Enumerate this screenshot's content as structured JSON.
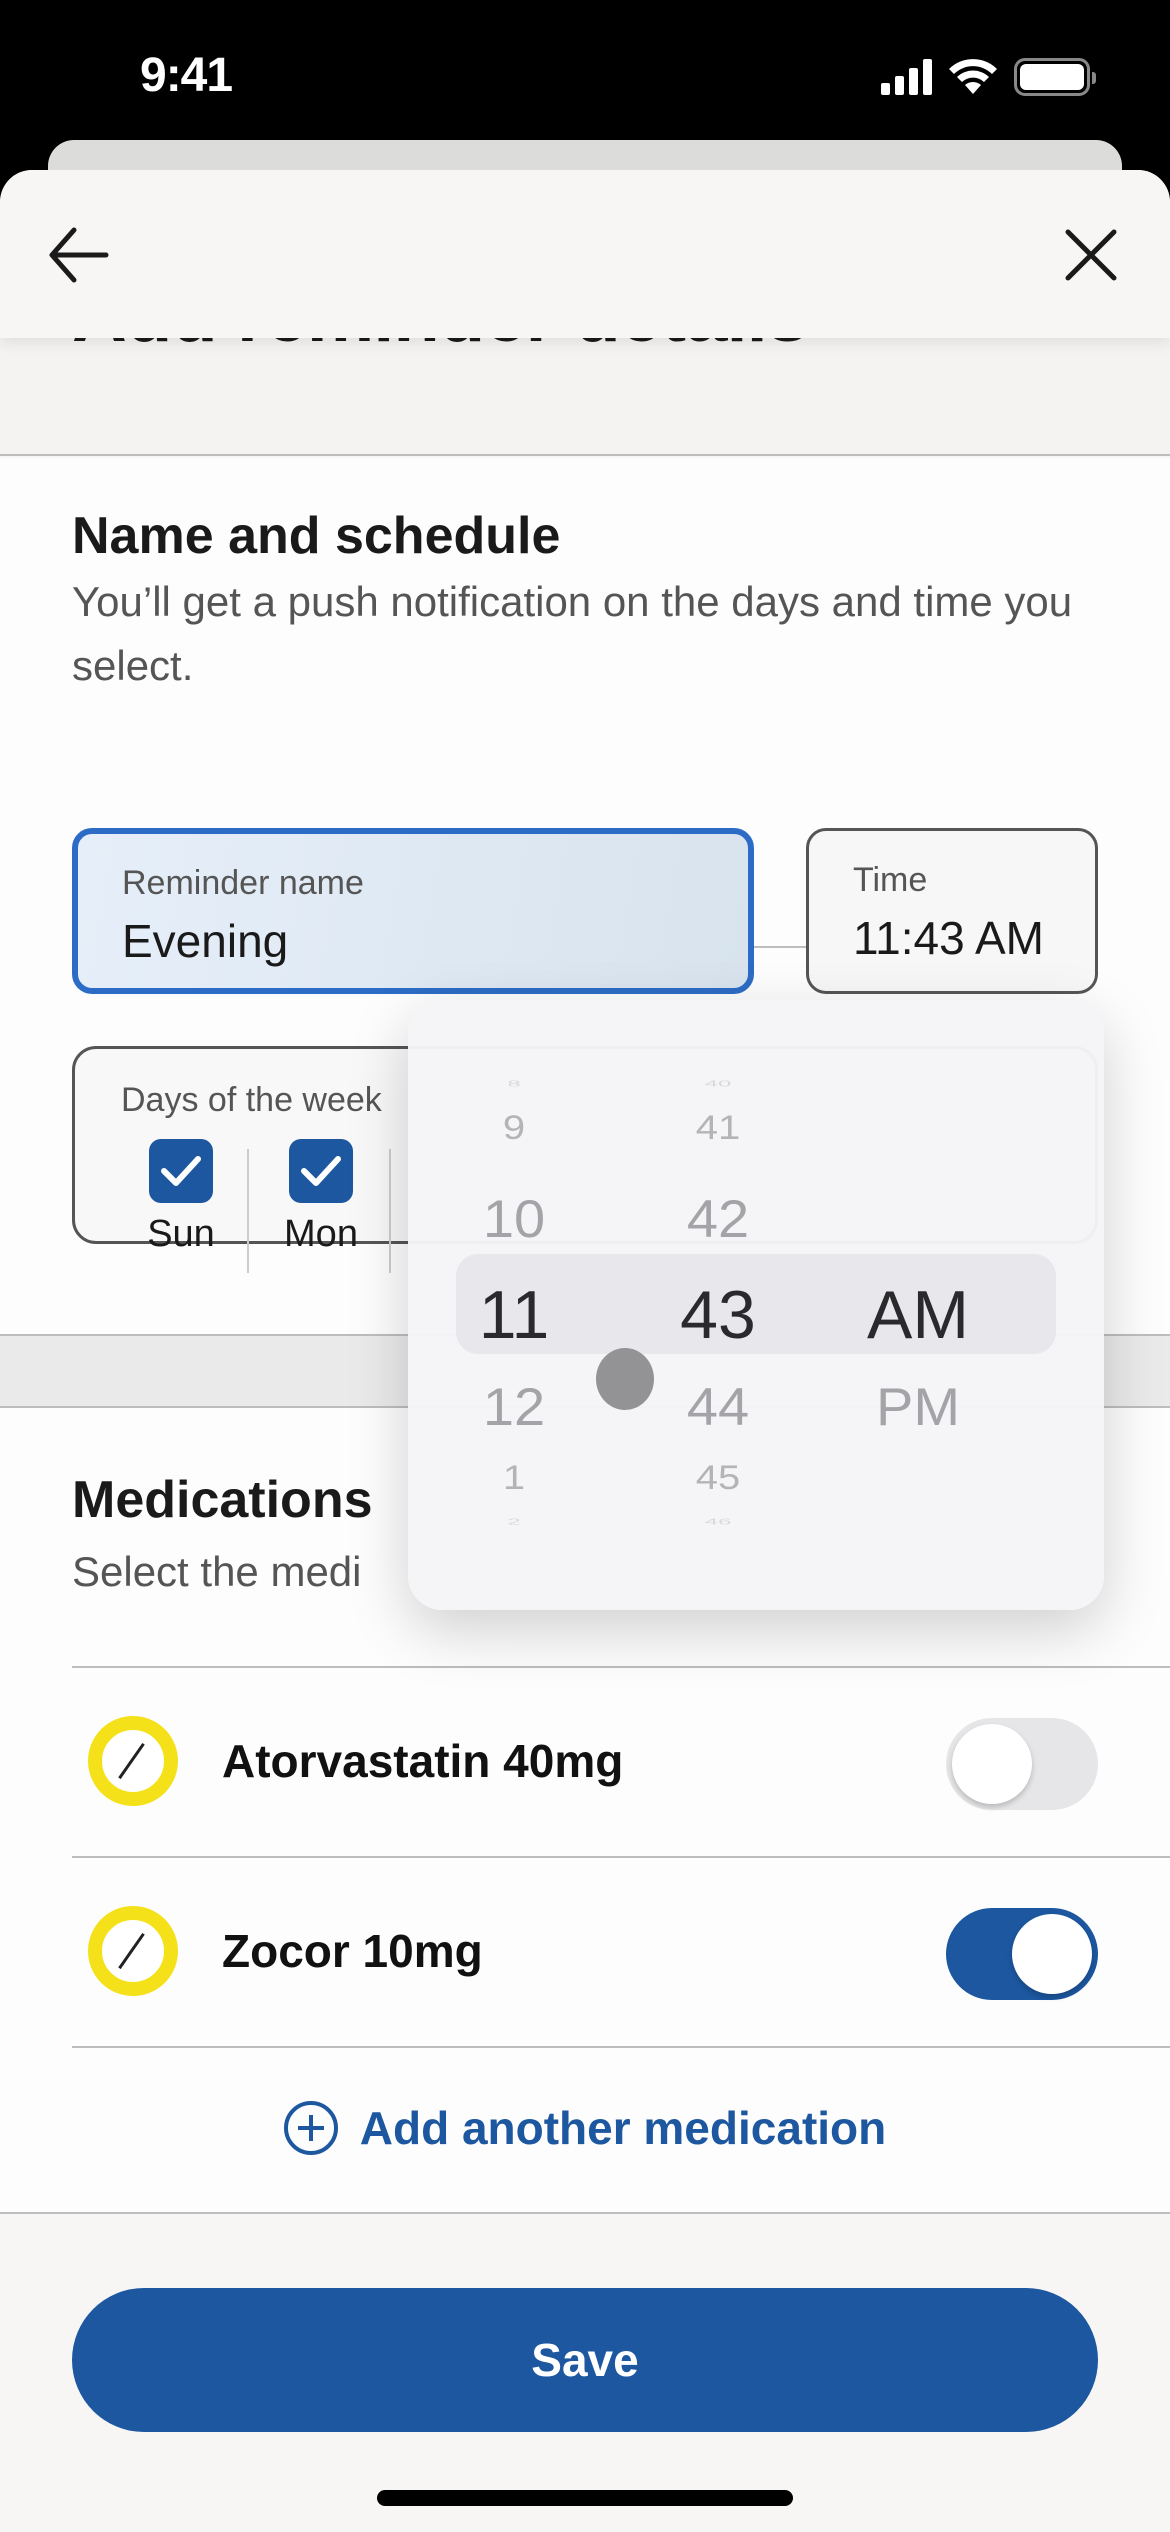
{
  "status_bar": {
    "time": "9:41",
    "icons": [
      "signal-icon",
      "wifi-icon",
      "battery-icon"
    ]
  },
  "nav": {
    "back_icon": "arrow-left-icon",
    "close_icon": "close-icon"
  },
  "page": {
    "title": "Add reminder details"
  },
  "schedule": {
    "title": "Name and schedule",
    "description": "You’ll get a push notification on the days and time you select.",
    "reminder_name": {
      "label": "Reminder name",
      "value": "Evening"
    },
    "time": {
      "label": "Time",
      "value": "11:43 AM"
    },
    "days": {
      "label": "Days of the week",
      "items": [
        {
          "name": "Sun",
          "checked": true
        },
        {
          "name": "Mon",
          "checked": true
        }
      ]
    }
  },
  "time_picker": {
    "hours": [
      "8",
      "9",
      "10",
      "11",
      "12",
      "1",
      "2"
    ],
    "minutes": [
      "40",
      "41",
      "42",
      "43",
      "44",
      "45",
      "46"
    ],
    "periods": [
      "AM",
      "PM"
    ],
    "selected": {
      "hour": "11",
      "minute": "43",
      "period": "AM"
    }
  },
  "medications": {
    "title": "Medications",
    "description": "Select the medi",
    "items": [
      {
        "name": "Atorvastatin 40mg",
        "enabled": false,
        "color": "#f5e11a"
      },
      {
        "name": "Zocor 10mg",
        "enabled": true,
        "color": "#f5e11a"
      }
    ],
    "add_label": "Add another medication"
  },
  "footer": {
    "save_label": "Save"
  },
  "colors": {
    "primary": "#1c57a0",
    "focus": "#2d6cc6",
    "pill": "#f5e11a"
  }
}
